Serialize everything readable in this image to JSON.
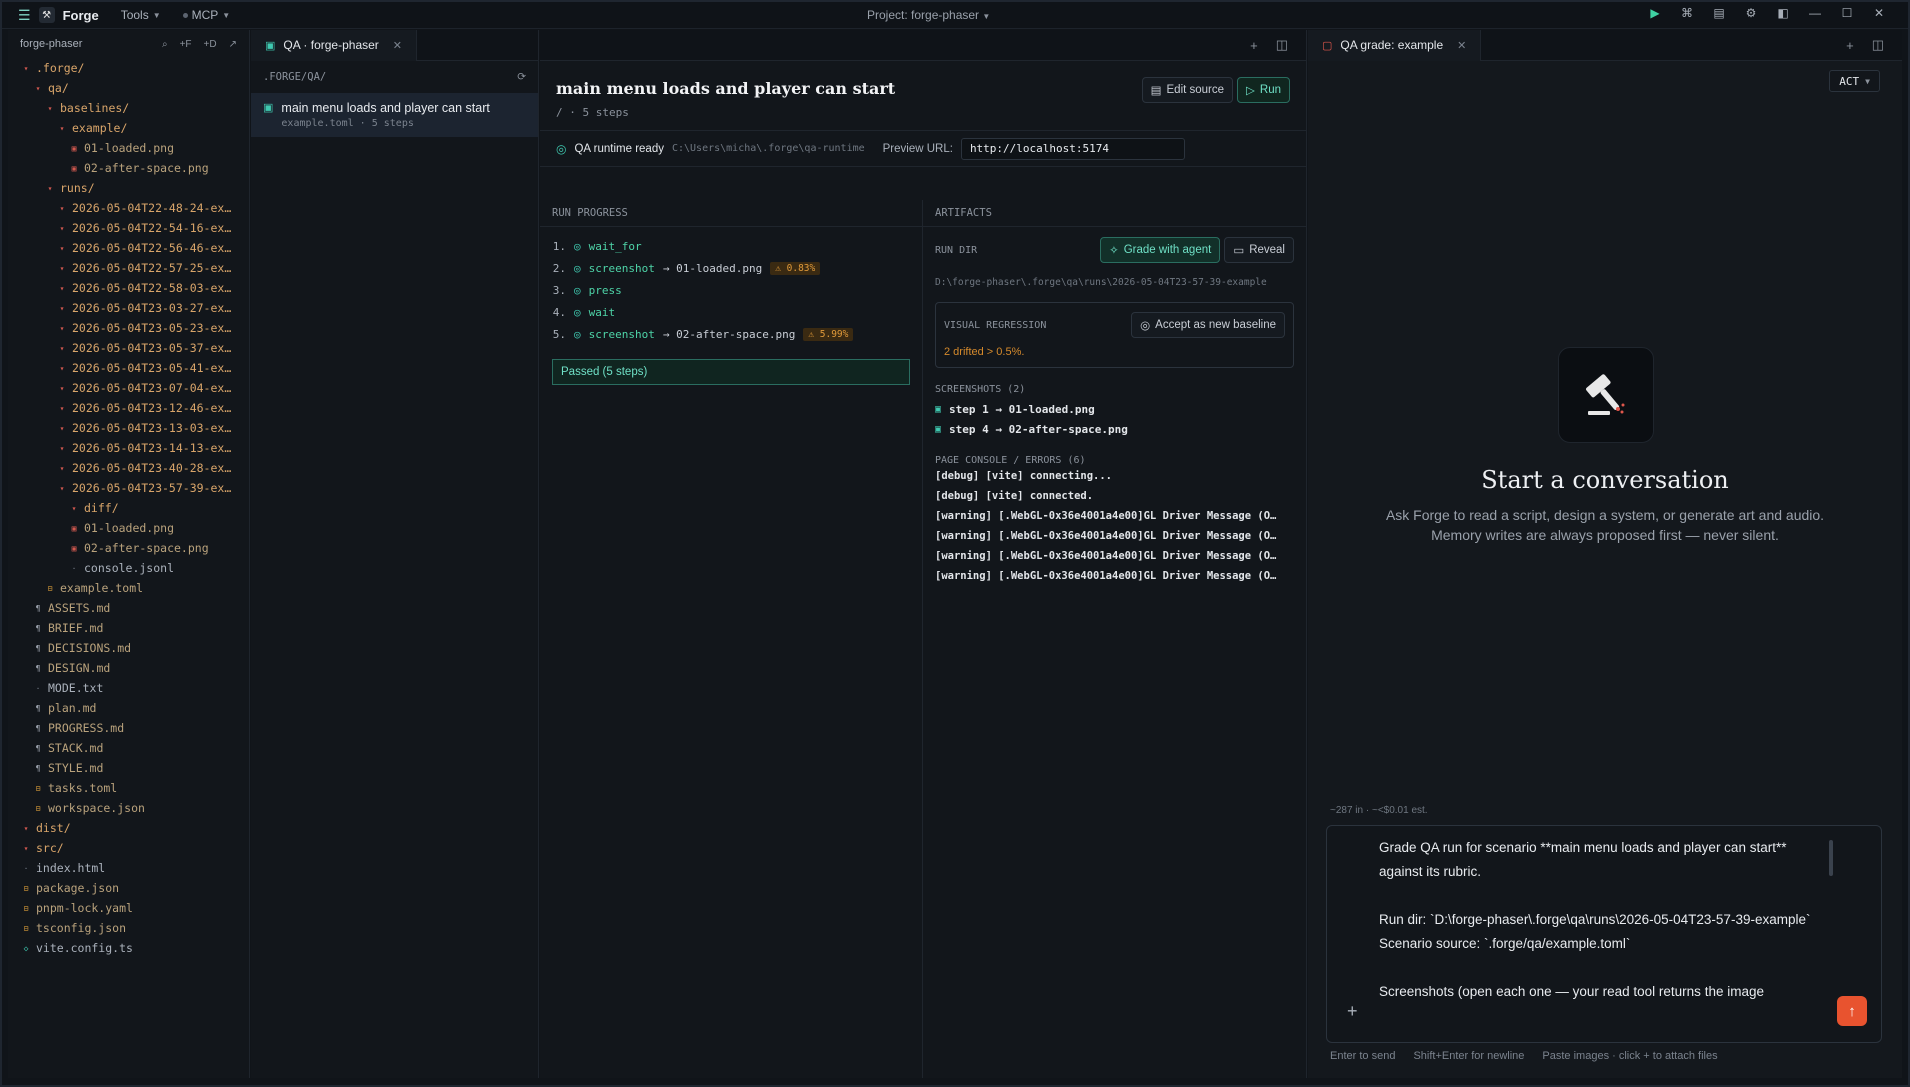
{
  "titlebar": {
    "app_name": "Forge",
    "menu_tools": "Tools",
    "menu_mcp": "MCP",
    "project": "Project: forge-phaser"
  },
  "explorer": {
    "title": "forge-phaser",
    "actions": [
      "⌕",
      "+F",
      "+D",
      "↗"
    ],
    "tree": [
      {
        "depth": 1,
        "type": "folder",
        "label": ".forge/"
      },
      {
        "depth": 2,
        "type": "folder",
        "label": "qa/"
      },
      {
        "depth": 3,
        "type": "folder",
        "label": "baselines/"
      },
      {
        "depth": 4,
        "type": "folder",
        "label": "example/"
      },
      {
        "depth": 5,
        "type": "png",
        "label": "01-loaded.png"
      },
      {
        "depth": 5,
        "type": "png",
        "label": "02-after-space.png"
      },
      {
        "depth": 3,
        "type": "folder",
        "label": "runs/"
      },
      {
        "depth": 4,
        "type": "folder",
        "label": "2026-05-04T22-48-24-ex…"
      },
      {
        "depth": 4,
        "type": "folder",
        "label": "2026-05-04T22-54-16-ex…"
      },
      {
        "depth": 4,
        "type": "folder",
        "label": "2026-05-04T22-56-46-ex…"
      },
      {
        "depth": 4,
        "type": "folder",
        "label": "2026-05-04T22-57-25-ex…"
      },
      {
        "depth": 4,
        "type": "folder",
        "label": "2026-05-04T22-58-03-ex…"
      },
      {
        "depth": 4,
        "type": "folder",
        "label": "2026-05-04T23-03-27-ex…"
      },
      {
        "depth": 4,
        "type": "folder",
        "label": "2026-05-04T23-05-23-ex…"
      },
      {
        "depth": 4,
        "type": "folder",
        "label": "2026-05-04T23-05-37-ex…"
      },
      {
        "depth": 4,
        "type": "folder",
        "label": "2026-05-04T23-05-41-ex…"
      },
      {
        "depth": 4,
        "type": "folder",
        "label": "2026-05-04T23-07-04-ex…"
      },
      {
        "depth": 4,
        "type": "folder",
        "label": "2026-05-04T23-12-46-ex…"
      },
      {
        "depth": 4,
        "type": "folder",
        "label": "2026-05-04T23-13-03-ex…"
      },
      {
        "depth": 4,
        "type": "folder",
        "label": "2026-05-04T23-14-13-ex…"
      },
      {
        "depth": 4,
        "type": "folder",
        "label": "2026-05-04T23-40-28-ex…"
      },
      {
        "depth": 4,
        "type": "folder",
        "label": "2026-05-04T23-57-39-ex…"
      },
      {
        "depth": 5,
        "type": "folder",
        "label": "diff/"
      },
      {
        "depth": 5,
        "type": "png",
        "label": "01-loaded.png"
      },
      {
        "depth": 5,
        "type": "png",
        "label": "02-after-space.png"
      },
      {
        "depth": 5,
        "type": "txt",
        "label": "console.jsonl"
      },
      {
        "depth": 3,
        "type": "toml",
        "label": "example.toml"
      },
      {
        "depth": 2,
        "type": "md",
        "label": "ASSETS.md"
      },
      {
        "depth": 2,
        "type": "md",
        "label": "BRIEF.md"
      },
      {
        "depth": 2,
        "type": "md",
        "label": "DECISIONS.md"
      },
      {
        "depth": 2,
        "type": "md",
        "label": "DESIGN.md"
      },
      {
        "depth": 2,
        "type": "txt",
        "label": "MODE.txt"
      },
      {
        "depth": 2,
        "type": "md",
        "label": "plan.md"
      },
      {
        "depth": 2,
        "type": "md",
        "label": "PROGRESS.md"
      },
      {
        "depth": 2,
        "type": "md",
        "label": "STACK.md"
      },
      {
        "depth": 2,
        "type": "md",
        "label": "STYLE.md"
      },
      {
        "depth": 2,
        "type": "toml",
        "label": "tasks.toml"
      },
      {
        "depth": 2,
        "type": "toml",
        "label": "workspace.json"
      },
      {
        "depth": 1,
        "type": "folder",
        "label": "dist/"
      },
      {
        "depth": 1,
        "type": "folder",
        "label": "src/"
      },
      {
        "depth": 1,
        "type": "txt",
        "label": "index.html"
      },
      {
        "depth": 1,
        "type": "toml",
        "label": "package.json"
      },
      {
        "depth": 1,
        "type": "toml",
        "label": "pnpm-lock.yaml"
      },
      {
        "depth": 1,
        "type": "toml",
        "label": "tsconfig.json"
      },
      {
        "depth": 1,
        "type": "ts",
        "label": "vite.config.ts"
      }
    ]
  },
  "scenarios": {
    "tab_label": "QA · forge-phaser",
    "path": ".FORGE/QA/",
    "item_title": "main menu loads and player can start",
    "item_sub": "example.toml · 5 steps"
  },
  "run": {
    "title": "main menu loads and player can start",
    "sub": "/ · 5 steps",
    "edit_label": "Edit source",
    "run_label": "Run",
    "runtime_label": "QA runtime ready",
    "runtime_path": "C:\\Users\\micha\\.forge\\qa-runtime",
    "preview_label": "Preview URL:",
    "preview_url": "http://localhost:5174",
    "progress_head": "RUN PROGRESS",
    "steps": [
      {
        "num": "1.",
        "name": "wait_for",
        "file": "",
        "drift": ""
      },
      {
        "num": "2.",
        "name": "screenshot",
        "file": "→ 01-loaded.png",
        "drift": "⚠ 0.83%"
      },
      {
        "num": "3.",
        "name": "press",
        "file": "",
        "drift": ""
      },
      {
        "num": "4.",
        "name": "wait",
        "file": "",
        "drift": ""
      },
      {
        "num": "5.",
        "name": "screenshot",
        "file": "→ 02-after-space.png",
        "drift": "⚠ 5.99%"
      }
    ],
    "passed": "Passed (5 steps)",
    "artifacts_head": "ARTIFACTS",
    "run_dir_label": "RUN DIR",
    "grade_label": "Grade with agent",
    "reveal_label": "Reveal",
    "run_dir_path": "D:\\forge-phaser\\.forge\\qa\\runs\\2026-05-04T23-57-39-example",
    "vr_label": "VISUAL REGRESSION",
    "accept_label": "Accept as new baseline",
    "vr_warn": "2 drifted > 0.5%.",
    "shots_head": "SCREENSHOTS (2)",
    "shots": [
      "step 1 → 01-loaded.png",
      "step 4 → 02-after-space.png"
    ],
    "console_head": "PAGE CONSOLE / ERRORS (6)",
    "console": [
      "[debug] [vite] connecting...",
      "[debug] [vite] connected.",
      "[warning] [.WebGL-0x36e4001a4e00]GL Driver Message (O…",
      "[warning] [.WebGL-0x36e4001a4e00]GL Driver Message (O…",
      "[warning] [.WebGL-0x36e4001a4e00]GL Driver Message (O…",
      "[warning] [.WebGL-0x36e4001a4e00]GL Driver Message (O…"
    ]
  },
  "chat": {
    "tab_label": "QA grade: example",
    "mode": "ACT",
    "empty_title": "Start a conversation",
    "empty_sub": "Ask Forge to read a script, design a system, or generate art and audio. Memory writes are always proposed first — never silent.",
    "usage": "~287 in · ~<$0.01 est.",
    "draft": "Grade QA run for scenario **main menu loads and player can start** against its rubric.\n\nRun dir: `D:\\forge-phaser\\.forge\\qa\\runs\\2026-05-04T23-57-39-example`\nScenario source: `.forge/qa/example.toml`\n\nScreenshots (open each one — your read tool returns the image",
    "hint_send": "Enter to send",
    "hint_newline": "Shift+Enter for newline",
    "hint_attach": "Paste images · click + to attach files"
  }
}
